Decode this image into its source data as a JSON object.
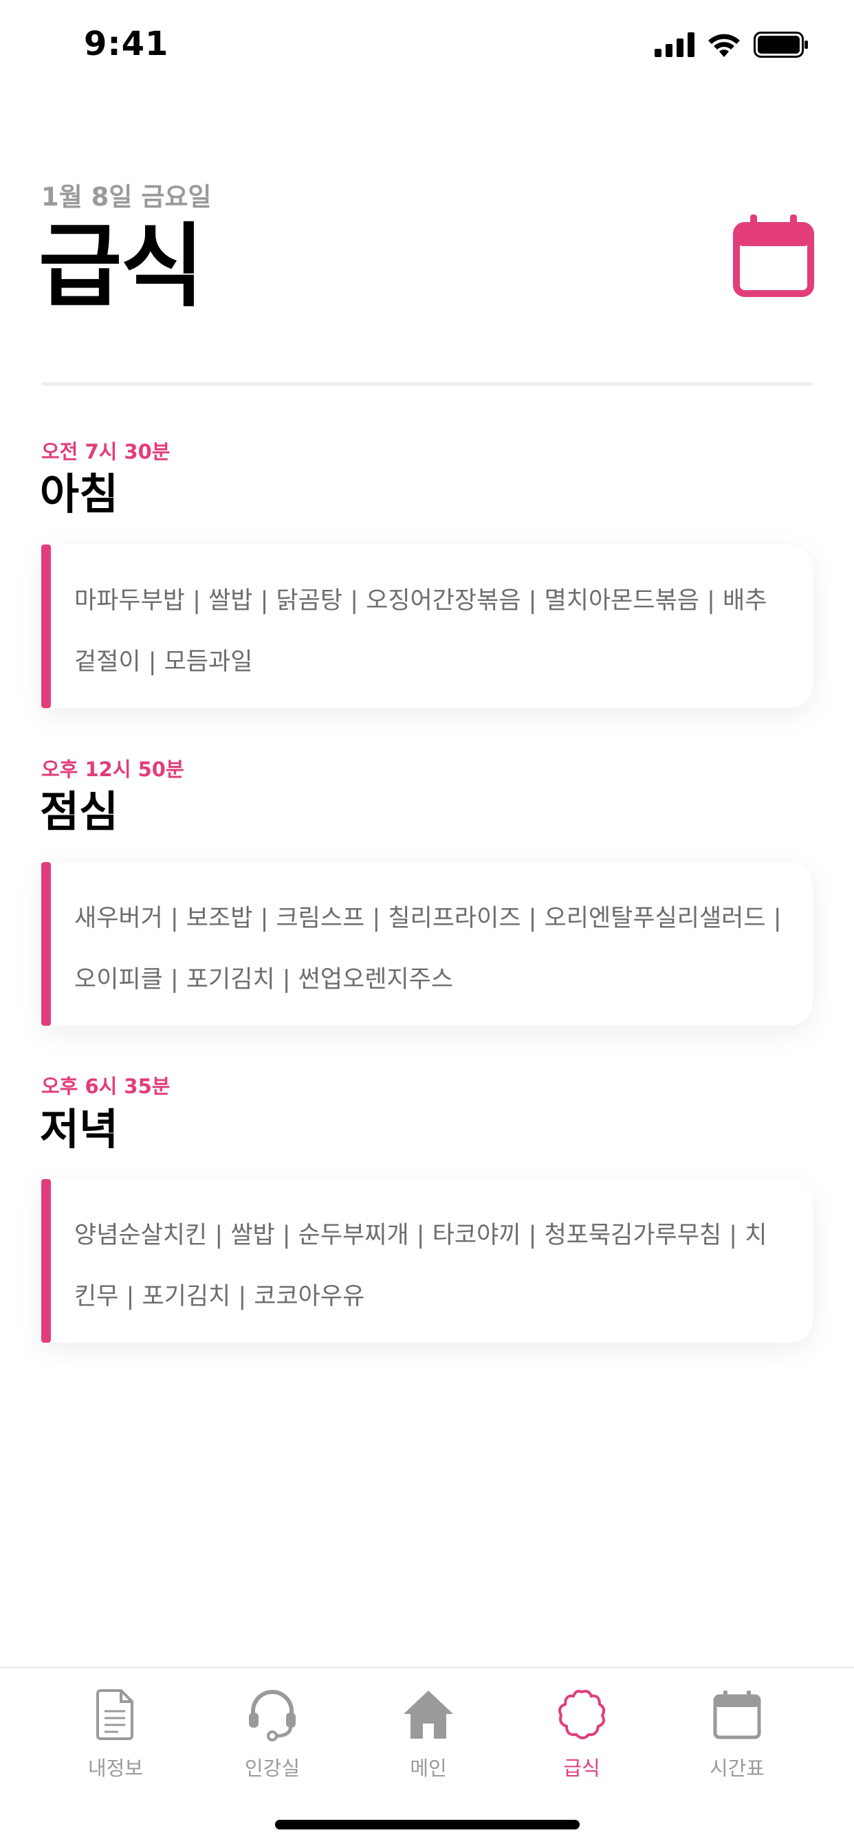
{
  "status_bar": {
    "time": "9:41"
  },
  "header": {
    "date": "1월 8일 금요일",
    "title": "급식"
  },
  "meals": [
    {
      "time": "오전 7시 30분",
      "name": "아침",
      "menu": "마파두부밥 | 쌀밥 | 닭곰탕 | 오징어간장볶음 | 멸치아몬드볶음 | 배추겉절이 | 모듬과일"
    },
    {
      "time": "오후 12시 50분",
      "name": "점심",
      "menu": "새우버거 | 보조밥 | 크림스프 | 칠리프라이즈 | 오리엔탈푸실리샐러드 | 오이피클 | 포기김치 | 썬업오렌지주스"
    },
    {
      "time": "오후 6시 35분",
      "name": "저녁",
      "menu": "양념순살치킨 | 쌀밥 | 순두부찌개 | 타코야끼 | 청포묵김가루무침 | 치킨무 | 포기김치 | 코코아우유"
    }
  ],
  "tab_bar": {
    "tabs": [
      {
        "label": "내정보",
        "icon": "document-icon"
      },
      {
        "label": "인강실",
        "icon": "headset-icon"
      },
      {
        "label": "메인",
        "icon": "home-icon"
      },
      {
        "label": "급식",
        "icon": "flower-icon",
        "active": true
      },
      {
        "label": "시간표",
        "icon": "calendar-icon"
      }
    ]
  },
  "colors": {
    "accent": "#e23d7a",
    "muted": "#9a9a9a",
    "menu_text": "#6d6d6d"
  }
}
